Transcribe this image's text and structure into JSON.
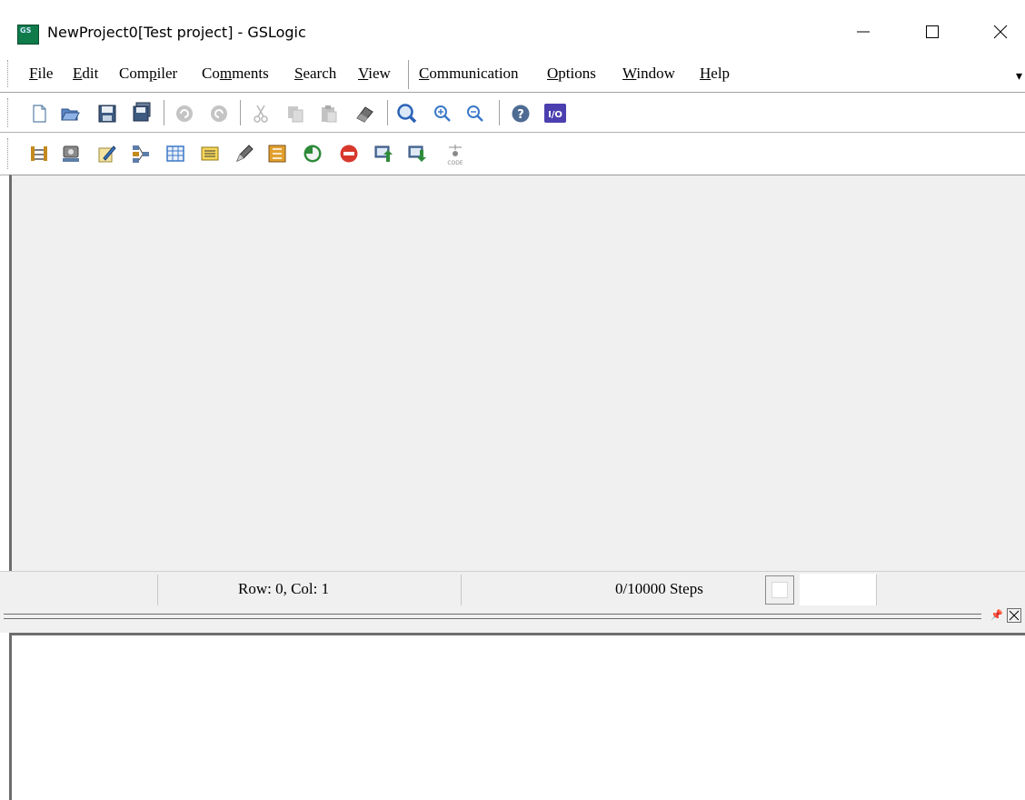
{
  "window": {
    "title": "NewProject0[Test project] - GSLogic",
    "minimize_icon": "minimize-icon",
    "maximize_icon": "maximize-icon",
    "close_icon": "close-icon"
  },
  "menu": {
    "items": [
      {
        "pre": "",
        "u": "F",
        "post": "ile"
      },
      {
        "pre": "",
        "u": "E",
        "post": "dit"
      },
      {
        "pre": "Com",
        "u": "p",
        "post": "iler"
      },
      {
        "pre": "Co",
        "u": "m",
        "post": "ments"
      },
      {
        "pre": "",
        "u": "S",
        "post": "earch"
      },
      {
        "pre": "",
        "u": "V",
        "post": "iew"
      },
      {
        "pre": "",
        "u": "C",
        "post": "ommunication"
      },
      {
        "pre": "",
        "u": "O",
        "post": "ptions"
      },
      {
        "pre": "",
        "u": "W",
        "post": "indow"
      },
      {
        "pre": "",
        "u": "H",
        "post": "elp"
      }
    ]
  },
  "toolbar1": {
    "icons": [
      "new-file-icon",
      "open-folder-icon",
      "save-icon",
      "save-all-icon",
      "undo-icon",
      "redo-icon",
      "cut-icon",
      "copy-icon",
      "paste-icon",
      "eraser-icon",
      "search-icon",
      "zoom-in-icon",
      "zoom-out-icon",
      "help-icon",
      "io-icon"
    ]
  },
  "toolbar2": {
    "icons": [
      "ladder-icon",
      "device-icon",
      "edit-icon",
      "network-icon",
      "table-icon",
      "memory-icon",
      "pen-icon",
      "program-icon",
      "run-icon",
      "stop-icon",
      "upload-icon",
      "download-icon",
      "code-icon"
    ]
  },
  "status": {
    "position": "Row: 0, Col: 1",
    "steps": "0/10000 Steps"
  },
  "output_panel": {
    "pin_icon": "pin-icon",
    "close_icon": "close-icon"
  },
  "colors": {
    "accent_blue": "#3a78c8",
    "io_purple": "#4b3fb0",
    "workspace_bg": "#f0f0f0"
  }
}
